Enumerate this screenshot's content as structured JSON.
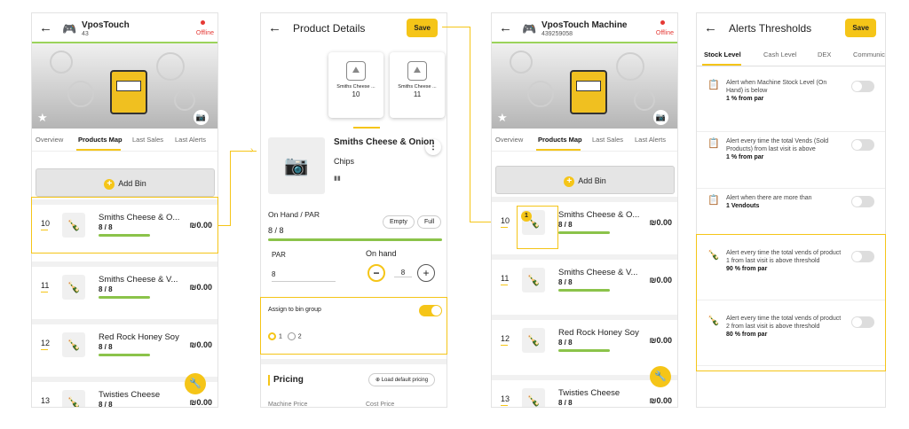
{
  "screen1": {
    "back": "←",
    "title": "VposTouch",
    "subtitle": "43",
    "status": "Offline",
    "tabs": [
      "Overview",
      "Products Map",
      "Last Sales",
      "Last Alerts"
    ],
    "add_bin": "Add Bin",
    "bins": [
      {
        "num": "10",
        "name": "Smiths Cheese & O...",
        "qty": "8 / 8",
        "price": "₪0.00"
      },
      {
        "num": "11",
        "name": "Smiths Cheese & V...",
        "qty": "8 / 8",
        "price": "₪0.00"
      },
      {
        "num": "12",
        "name": "Red Rock Honey Soy",
        "qty": "8 / 8",
        "price": "₪0.00"
      },
      {
        "num": "13",
        "name": "Twisties Cheese",
        "qty": "8 / 8",
        "price": "₪0.00"
      }
    ]
  },
  "screen2": {
    "back": "←",
    "title": "Product Details",
    "save": "Save",
    "thumbs": [
      {
        "name": "Smiths Cheese ...",
        "value": "10"
      },
      {
        "name": "Smiths Cheese ...",
        "value": "11"
      }
    ],
    "product_name": "Smiths Cheese & Onion",
    "product_category": "Chips",
    "on_hand_par_label": "On Hand / PAR",
    "on_hand_par_value": "8 / 8",
    "empty": "Empty",
    "full": "Full",
    "par_label": "PAR",
    "par_value": "8",
    "on_hand_label": "On hand",
    "on_hand_value": "8",
    "minus": "−",
    "plus": "+",
    "assign_label": "Assign to bin group",
    "radio1": "1",
    "radio2": "2",
    "pricing": "Pricing",
    "load_pricing": "Load default pricing",
    "machine_price": "Machine Price",
    "cost_price": "Cost Price"
  },
  "screen3": {
    "back": "←",
    "title": "VposTouch Machine",
    "subtitle": "439259058",
    "status": "Offline",
    "tabs": [
      "Overview",
      "Products Map",
      "Last Sales",
      "Last Alerts"
    ],
    "add_bin": "Add Bin",
    "badge": "1",
    "bins": [
      {
        "num": "10",
        "name": "Smiths Cheese & O...",
        "qty": "8 / 8",
        "price": "₪0.00"
      },
      {
        "num": "11",
        "name": "Smiths Cheese & V...",
        "qty": "8 / 8",
        "price": "₪0.00"
      },
      {
        "num": "12",
        "name": "Red Rock Honey Soy",
        "qty": "8 / 8",
        "price": "₪0.00"
      },
      {
        "num": "13",
        "name": "Twisties Cheese",
        "qty": "8 / 8",
        "price": "₪0.00"
      }
    ]
  },
  "screen4": {
    "back": "←",
    "title": "Alerts Thresholds",
    "save": "Save",
    "tabs": [
      "Stock Level",
      "Cash Level",
      "DEX",
      "Communic"
    ],
    "alerts": [
      {
        "text": "Alert when Machine Stock Level (On Hand) is below",
        "value": "1 % from par"
      },
      {
        "text": "Alert every time the total Vends (Sold Products) from last visit is above",
        "value": "1 % from par"
      },
      {
        "text": "Alert when there are more than",
        "value": "1 Vendouts"
      },
      {
        "text": "Alert every time the total vends of product 1 from last visit is above threshold",
        "value": "90 % from par"
      },
      {
        "text": "Alert every time the total vends of product 2 from last visit is above threshold",
        "value": "80 % from par"
      }
    ]
  },
  "colors": {
    "accent": "#f5c518",
    "bar": "#8bc34a",
    "offline": "#e53935"
  },
  "icons": [
    "gamepad-icon",
    "camera-icon",
    "star-icon",
    "bottle-icon",
    "wrench-icon",
    "image-icon",
    "alert-icon"
  ]
}
